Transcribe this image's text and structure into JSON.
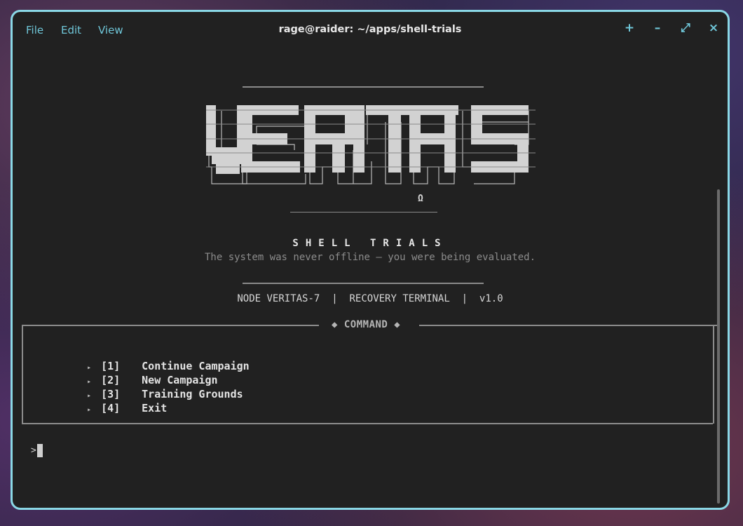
{
  "window": {
    "title": "rage@raider: ~/apps/shell-trials",
    "menu": [
      "File",
      "Edit",
      "View"
    ],
    "controls": {
      "new_tab": "+",
      "minimize": "–",
      "maximize": "⤢",
      "close": "×"
    }
  },
  "banner": {
    "logo_text": "VERITAS",
    "omega": "Ω",
    "subtitle": "SHELL TRIALS",
    "tagline": "The system was never offline — you were being evaluated.",
    "info": "NODE VERITAS-7  |  RECOVERY TERMINAL  |  v1.0"
  },
  "command_box": {
    "title": "◆ COMMAND ◆",
    "items": [
      {
        "key": "[1]",
        "label": "Continue Campaign"
      },
      {
        "key": "[2]",
        "label": "New Campaign"
      },
      {
        "key": "[3]",
        "label": "Training Grounds"
      },
      {
        "key": "[4]",
        "label": "Exit"
      }
    ],
    "bullet": "▸"
  },
  "prompt": {
    "symbol": ">"
  },
  "colors": {
    "accent": "#8ad8e6",
    "menu": "#6fc6d8",
    "background": "#212121",
    "block": "#cfcfcf"
  }
}
